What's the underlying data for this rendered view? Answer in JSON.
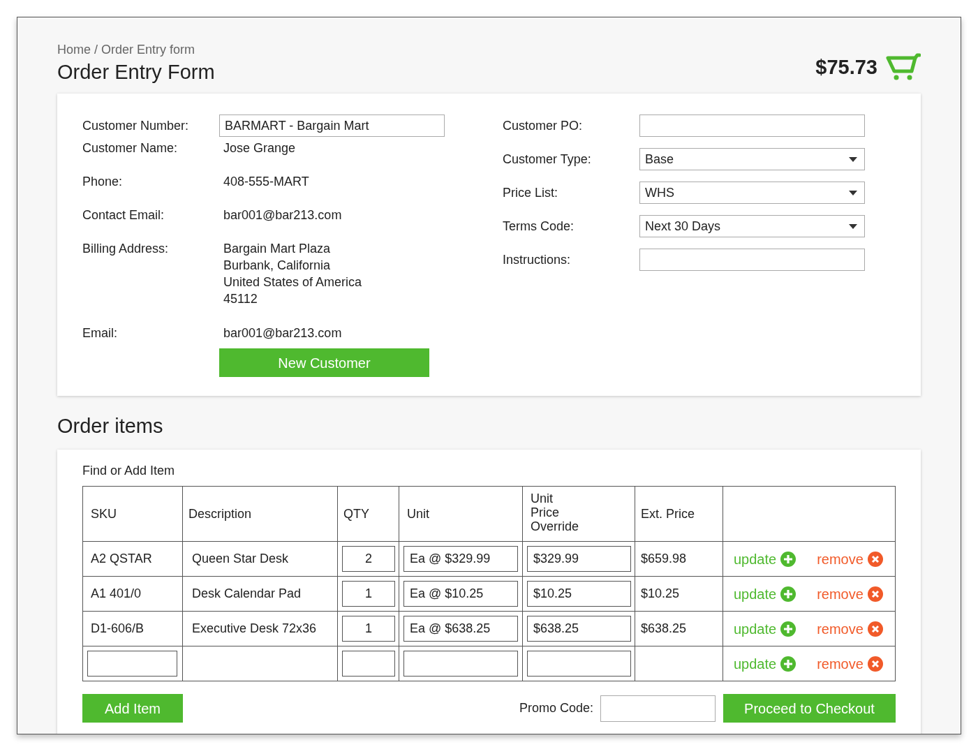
{
  "breadcrumb": "Home / Order Entry form",
  "title": "Order Entry Form",
  "cart_total": "$75.73",
  "customer": {
    "left_fields": [
      {
        "label": "Customer Number:",
        "kind": "input",
        "value": "BARMART - Bargain Mart"
      },
      {
        "label": "Customer Name:",
        "kind": "text",
        "lines": [
          "Jose Grange"
        ]
      },
      {
        "label": "Phone:",
        "kind": "text",
        "lines": [
          "408-555-MART"
        ]
      },
      {
        "label": "Contact Email:",
        "kind": "text",
        "lines": [
          "bar001@bar213.com"
        ]
      },
      {
        "label": "Billing Address:",
        "kind": "text",
        "lines": [
          "Bargain Mart Plaza",
          "Burbank, California",
          "United States of America",
          "45112"
        ]
      },
      {
        "label": "Email:",
        "kind": "text",
        "lines": [
          "bar001@bar213.com"
        ]
      }
    ],
    "new_customer_button": "New Customer",
    "right_fields": [
      {
        "label": "Customer PO:",
        "kind": "input"
      },
      {
        "label": "Customer Type:",
        "kind": "select",
        "value": "Base"
      },
      {
        "label": "Price List:",
        "kind": "select",
        "value": "WHS"
      },
      {
        "label": "Terms Code:",
        "kind": "select",
        "value": "Next 30 Days"
      },
      {
        "label": "Instructions:",
        "kind": "input"
      }
    ]
  },
  "items": {
    "title": "Order items",
    "find_label": "Find or Add Item",
    "columns": [
      "SKU",
      "Description",
      "QTY",
      "Unit",
      "Unit\nPrice\nOverride",
      "Ext. Price"
    ],
    "rows": [
      {
        "kind": "item",
        "sku": "A2 QSTAR",
        "description": "Queen Star Desk",
        "qty": "2",
        "unit": "Ea @ $329.99",
        "price_override": "$329.99",
        "ext_price": "$659.98",
        "update": "update",
        "remove": "remove"
      },
      {
        "kind": "item",
        "sku": "A1 401/0",
        "description": "Desk Calendar Pad",
        "qty": "1",
        "unit": "Ea @ $10.25",
        "price_override": "$10.25",
        "ext_price": "$10.25",
        "update": "update",
        "remove": "remove"
      },
      {
        "kind": "item",
        "sku": "D1-606/B",
        "description": "Executive Desk 72x36",
        "qty": "1",
        "unit": "Ea @ $638.25",
        "price_override": "$638.25",
        "ext_price": "$638.25",
        "update": "update",
        "remove": "remove"
      },
      {
        "kind": "new",
        "update": "update",
        "remove": "remove"
      }
    ],
    "add_item_button": "Add Item",
    "promo_label": "Promo Code:",
    "checkout_button": "Proceed to Checkout"
  }
}
